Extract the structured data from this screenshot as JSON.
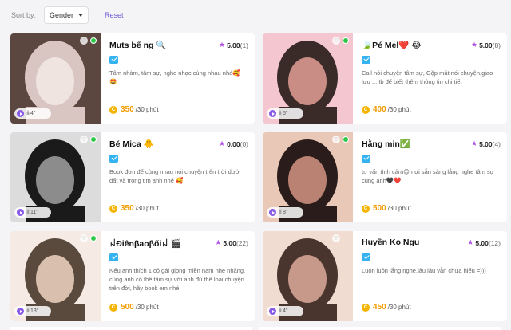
{
  "sort": {
    "label": "Sort by:",
    "selected": "Gender",
    "reset": "Reset"
  },
  "cards": [
    {
      "name": "Muts bế ng 🔍",
      "rating": "5.00",
      "count": "(1)",
      "bio": "Tâm nhàm, tâm sự, nghe nhạc cùng nhau nhé🥰\n🤩",
      "price": "350",
      "unit": "/30 phút",
      "voice": "4\"",
      "online": true,
      "colors": [
        "#d9c6c2",
        "#f0e4e0",
        "#5b4640"
      ]
    },
    {
      "name": "🍃Pé Mel❤️ 😂",
      "rating": "5.00",
      "count": "(8)",
      "bio": "Call nói chuyện tâm sự, Gặp mặt nói chuyện,giao lưu ... Ib để biết thêm thông tin chi tiết",
      "price": "400",
      "unit": "/30 phút",
      "voice": "5\"",
      "online": true,
      "colors": [
        "#3a2a28",
        "#c98d86",
        "#f4c6d0"
      ]
    },
    {
      "name": "Bé Mica 🐥",
      "rating": "0.00",
      "count": "(0)",
      "bio": "Book đơn để cùng nhau nói chuyện trên trời dưới đất và trong tim anh nhé 🥰",
      "price": "350",
      "unit": "/30 phút",
      "voice": "11\"",
      "online": true,
      "colors": [
        "#1a1a1a",
        "#8c8c8c",
        "#dcdcdc"
      ]
    },
    {
      "name": "Hằng min✅",
      "rating": "5.00",
      "count": "(4)",
      "bio": "tư vấn tình cảm😊 nơi sẵn sàng lắng nghe tâm sự cùng anh🖤❤️",
      "price": "500",
      "unit": "/30 phút",
      "voice": "8\"",
      "online": true,
      "colors": [
        "#2a1c1a",
        "#b98272",
        "#e9c8b8"
      ]
    },
    {
      "name": "ꈤĐiênβaoβốiꈤ 🎬",
      "rating": "5.00",
      "count": "(22)",
      "bio": "Nếu anh thích 1 cô gái giọng miền nam nhẹ nhàng, cùng anh có thể tâm sự với anh đủ thể loại chuyện trên đời, hãy book em nhé",
      "price": "500",
      "unit": "/30 phút",
      "voice": "13\"",
      "online": true,
      "colors": [
        "#5a4a3e",
        "#d8bfae",
        "#f5ebe4"
      ]
    },
    {
      "name": "Huyền Ko Ngu",
      "rating": "5.00",
      "count": "(12)",
      "bio": "Luôn luôn lắng nghe,lâu lâu vẫn chưa hiểu =)))",
      "price": "450",
      "unit": "/30 phút",
      "voice": "4\"",
      "online": false,
      "colors": [
        "#4a342e",
        "#c6998a",
        "#f1dcd2"
      ]
    }
  ]
}
